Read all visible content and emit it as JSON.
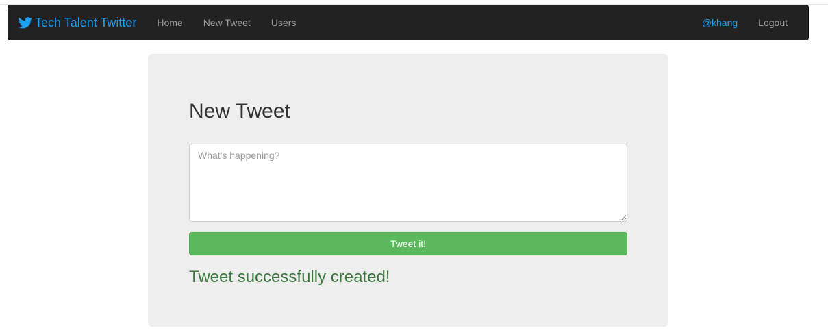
{
  "navbar": {
    "brand": "Tech Talent Twitter",
    "links": [
      {
        "label": "Home"
      },
      {
        "label": "New Tweet"
      },
      {
        "label": "Users"
      }
    ],
    "user": "@khang",
    "logout": "Logout"
  },
  "form": {
    "title": "New Tweet",
    "placeholder": "What's happening?",
    "value": "",
    "submit_label": "Tweet it!"
  },
  "message": {
    "success": "Tweet successfully created!"
  },
  "colors": {
    "brand": "#1da1f2",
    "navbar_bg": "#222222",
    "button": "#5cb85c",
    "success_text": "#3c763d"
  },
  "icons": {
    "brand": "twitter-bird-icon"
  }
}
